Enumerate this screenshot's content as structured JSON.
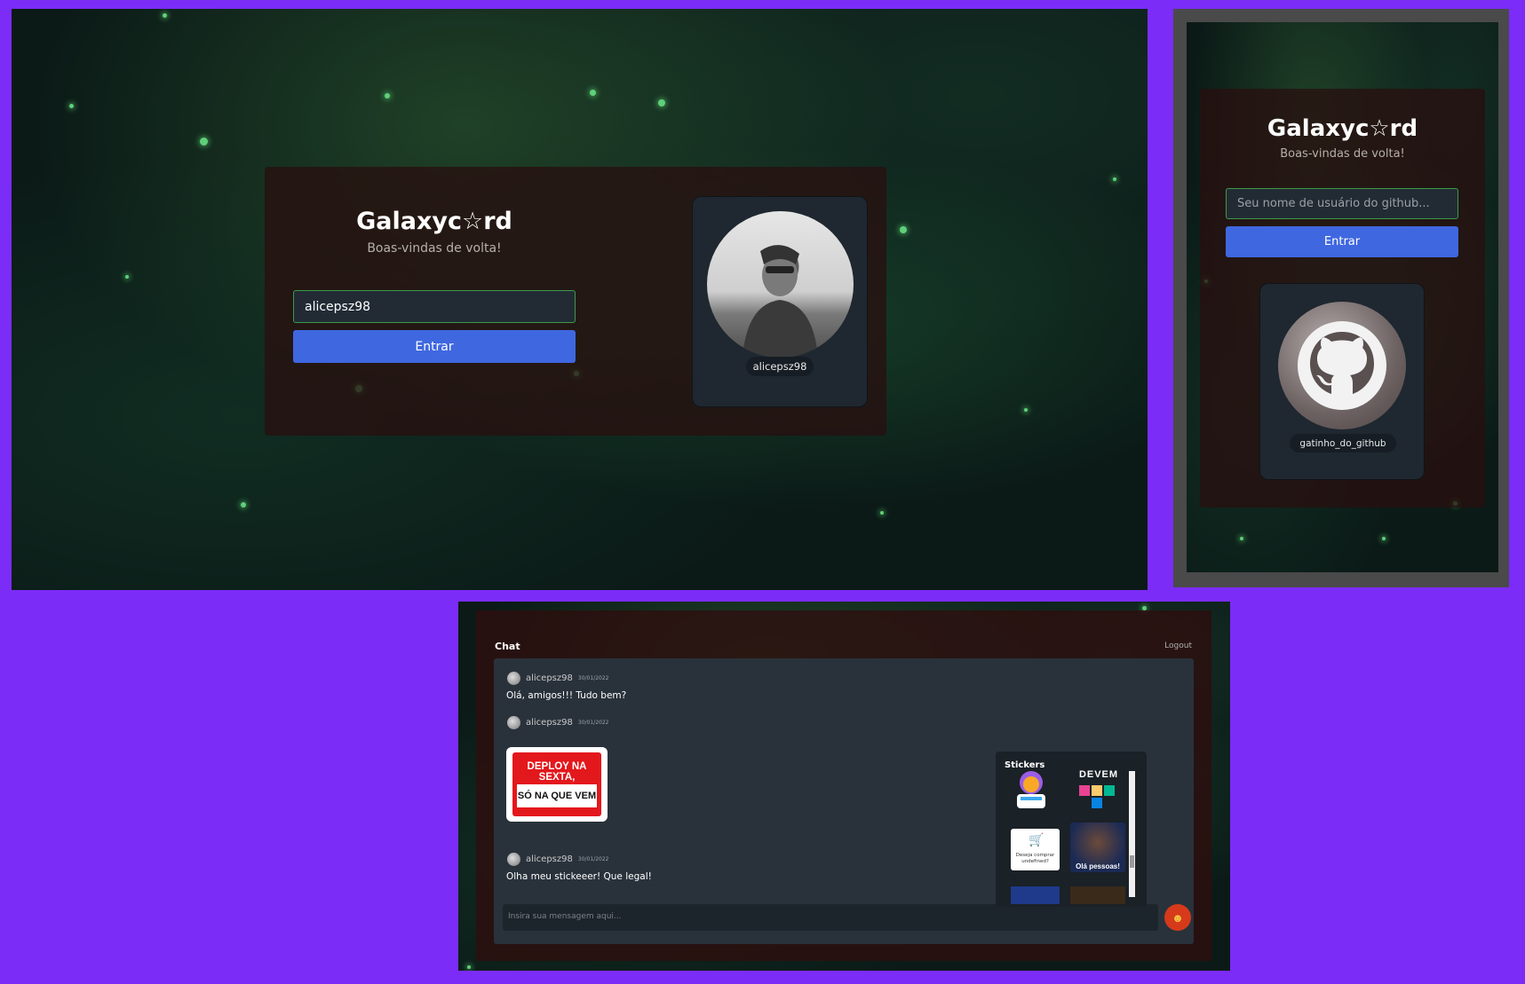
{
  "desktop": {
    "brand": "Galaxyc☆rd",
    "subtitle": "Boas-vindas de volta!",
    "username_value": "alicepsz98",
    "login_button": "Entrar",
    "profile_username": "alicepsz98"
  },
  "mobile": {
    "brand": "Galaxyc☆rd",
    "subtitle": "Boas-vindas de volta!",
    "username_placeholder": "Seu nome de usuário do github...",
    "login_button": "Entrar",
    "profile_username": "gatinho_do_github"
  },
  "chat": {
    "title": "Chat",
    "logout": "Logout",
    "messages": [
      {
        "user": "alicepsz98",
        "date": "30/01/2022",
        "text": "Olá, amigos!!! Tudo bem?"
      },
      {
        "user": "alicepsz98",
        "date": "30/01/2022",
        "sticker_line1": "DEPLOY NA SEXTA,",
        "sticker_line2": "SÓ NA QUE VEM"
      },
      {
        "user": "alicepsz98",
        "date": "30/01/2022",
        "text": "Olha meu stickeeer! Que legal!"
      }
    ],
    "input_placeholder": "Insira sua mensagem aqui...",
    "stickers": {
      "title": "Stickers",
      "item1": "DEVEM",
      "item2": "Deseja comprar undefined?",
      "item3": "Olá pessoas!"
    }
  },
  "colors": {
    "background": "#7b2cf7",
    "button": "#3f67e0",
    "input_border": "#3c9a4c",
    "card": "#2a0f0f"
  }
}
